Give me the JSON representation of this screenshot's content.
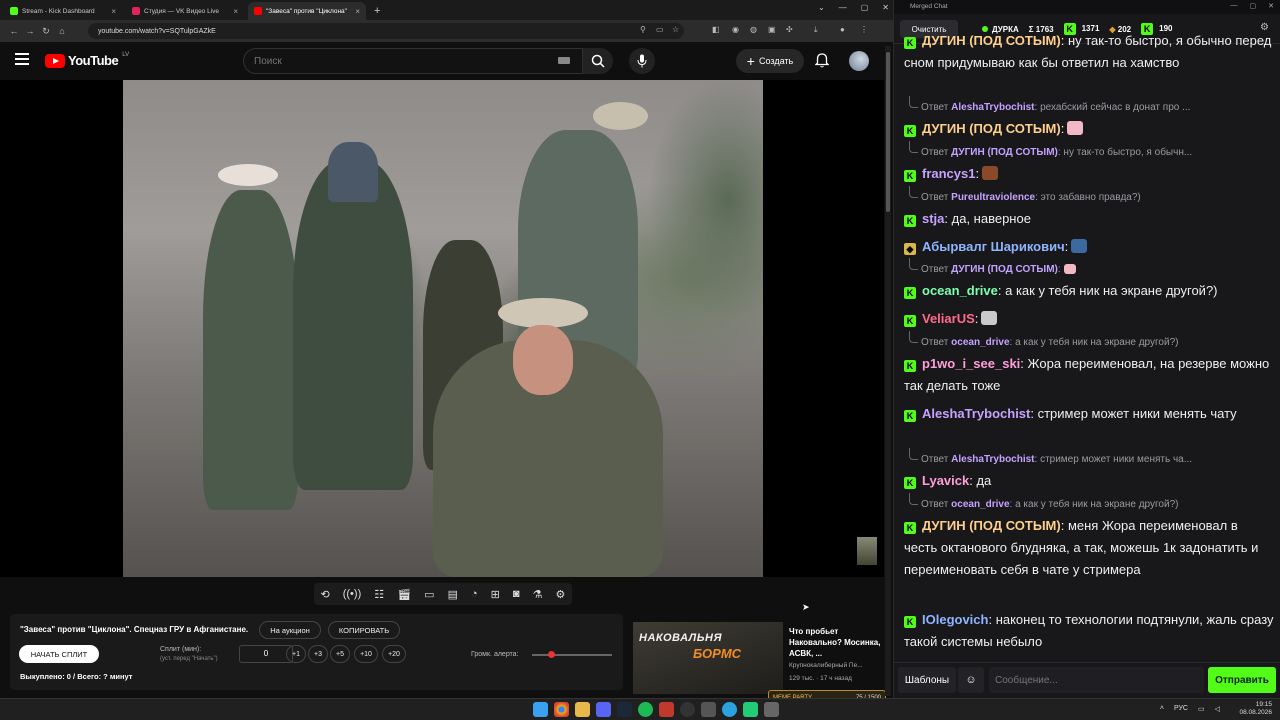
{
  "browser": {
    "tabs": [
      {
        "label": "Stream - Kick Dashboard",
        "color": "#53fc18"
      },
      {
        "label": "Студия — VK Видео Live",
        "color": "#e0245e"
      },
      {
        "label": "\"Завеса\" против \"Циклона\"",
        "color": "#ff0000"
      }
    ],
    "url": "youtube.com/watch?v=SQTulpGAZkE"
  },
  "youtube": {
    "logo": "YouTube",
    "region": "LV",
    "search_placeholder": "Поиск",
    "create_label": "Создать"
  },
  "panel": {
    "title": "\"Завеса\" против \"Циклона\". Спецназ ГРУ в Афганистане.",
    "auction_label": "На аукцион",
    "copy_label": "КОПИРОВАТЬ",
    "start_split_label": "НАЧАТЬ СПЛИТ",
    "split_label": "Сплит (мин):",
    "split_sub": "(уст. перед \"Начать\")",
    "split_value": "0",
    "increments": [
      "+1",
      "+3",
      "+5",
      "+10",
      "+20"
    ],
    "alert_label": "Громк. алерта:",
    "alert_level": 0.2,
    "bought": "Выкуплено: 0 / Всего: ? минут"
  },
  "recommendation": {
    "thumb_text_1": "НАКОВАЛЬНЯ",
    "thumb_text_2": "БОРМС",
    "title": "Что пробьет Наковально? Мосинка, АСВК, ...",
    "channel": "Крупнокалиберный Пе...",
    "meta": "129 тыс. · 17 ч назад"
  },
  "meme_party": {
    "label": "MEME PARTY",
    "count": "75 / 1500"
  },
  "chat": {
    "window_title": "Merged Chat",
    "clear_label": "Очистить",
    "channel": "ДУРКА",
    "stat_sum": "Σ 1763",
    "stat_kick": "1371",
    "stat_other": "202",
    "stat_fourth": "190",
    "messages": [
      {
        "user": "ДУГИН (ПОД СОТЫМ)",
        "color": "#ffd08a",
        "text": ": ну так-то быстро, я обычно перед сном придумываю как бы ответил на хамство"
      },
      {
        "reply_prefix": "Ответ",
        "reply_user": "AleshaTrybochist",
        "reply_text": ": рехабский сейчас в донат про ..."
      },
      {
        "user": "ДУГИН (ПОД СОТЫМ)",
        "color": "#ffd08a",
        "text": ":"
      },
      {
        "reply_prefix": "Ответ",
        "reply_user": "ДУГИН (ПОД СОТЫМ)",
        "reply_text": ": ну так-то быстро, я обычн..."
      },
      {
        "user": "francys1",
        "color": "#c6a2ff",
        "text": ":"
      },
      {
        "reply_prefix": "Ответ",
        "reply_user": "Pureultraviolence",
        "reply_text": ": это забавно правда?)"
      },
      {
        "user": "stja",
        "color": "#c6a2ff",
        "text": ": да, наверное"
      },
      {
        "user": "Абырвалг Шарикович",
        "color": "#8fb4ff",
        "text": ":"
      },
      {
        "reply_prefix": "Ответ",
        "reply_user": "ДУГИН (ПОД СОТЫМ)",
        "reply_text": ":"
      },
      {
        "user": "ocean_drive",
        "color": "#7dffb0",
        "text": ": а как у тебя ник на экране другой?)"
      },
      {
        "user": "VeliarUS",
        "color": "#ff6b8a",
        "text": ":"
      },
      {
        "reply_prefix": "Ответ",
        "reply_user": "ocean_drive",
        "reply_text": ": а как у тебя ник на экране другой?)"
      },
      {
        "user": "p1wo_i_see_ski",
        "color": "#ff9ed8",
        "text": ": Жора переименовал, на резерве можно так делать тоже"
      },
      {
        "user": "AleshaTrybochist",
        "color": "#c6a2ff",
        "text": ": стример может ники менять чату"
      },
      {
        "reply_prefix": "Ответ",
        "reply_user": "AleshaTrybochist",
        "reply_text": ": стример может ники менять ча..."
      },
      {
        "user": "Lyavick",
        "color": "#ff9ed8",
        "text": ": да"
      },
      {
        "reply_prefix": "Ответ",
        "reply_user": "ocean_drive",
        "reply_text": ": а как у тебя ник на экране другой?)"
      },
      {
        "user": "ДУГИН (ПОД СОТЫМ)",
        "color": "#ffd08a",
        "text": ": меня Жора переименовал в честь октанового блудняка, а так, можешь 1к задонатить и переименовать себя в чате у стримера"
      },
      {
        "user": "IOlegovich",
        "color": "#8fb4ff",
        "text": ": наконец то технологии подтянули, жаль сразу такой системы небыло"
      }
    ],
    "templates_label": "Шаблоны",
    "input_placeholder": "Сообщение...",
    "send_label": "Отправить"
  },
  "taskbar": {
    "lang": "РУС",
    "time": "19:15",
    "date": "08.08.2026"
  }
}
